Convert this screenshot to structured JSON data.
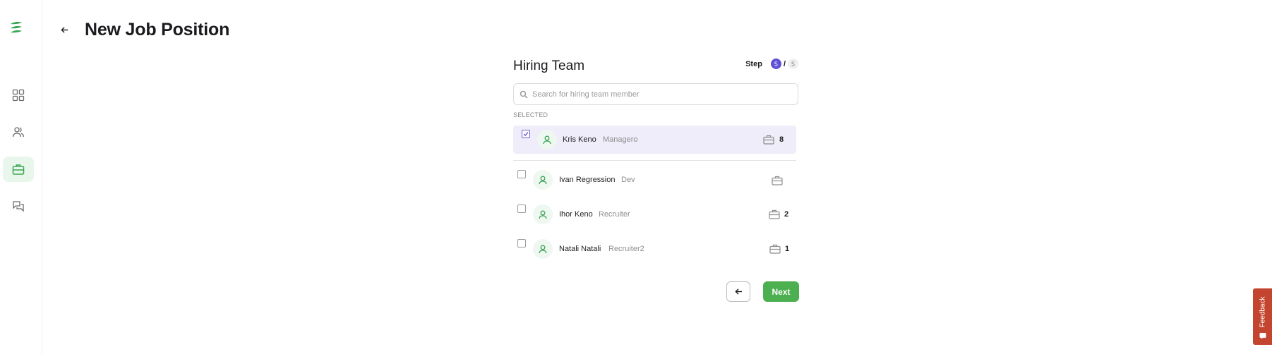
{
  "page": {
    "title": "New Job Position"
  },
  "sidebar": {
    "items": [
      {
        "name": "dashboard",
        "icon": "grid-icon"
      },
      {
        "name": "candidates",
        "icon": "users-icon"
      },
      {
        "name": "jobs",
        "icon": "briefcase-icon",
        "active": true
      },
      {
        "name": "messages",
        "icon": "chat-icon"
      }
    ]
  },
  "wizard": {
    "section_title": "Hiring Team",
    "step_label": "Step",
    "step_current": "5",
    "step_separator": "/",
    "step_total": "5"
  },
  "search": {
    "placeholder": "Search for hiring team member",
    "value": ""
  },
  "selected_label": "SELECTED",
  "selected_members": [
    {
      "name": "Kris Keno",
      "role": "Managero",
      "jobs": "8",
      "checked": true
    }
  ],
  "members": [
    {
      "name": "Ivan Regression",
      "role": "Dev",
      "jobs": "",
      "checked": false
    },
    {
      "name": "Ihor Keno",
      "role": "Recruiter",
      "jobs": "2",
      "checked": false
    },
    {
      "name": "Natali Natali",
      "role": "Recruiter2",
      "jobs": "1",
      "checked": false
    }
  ],
  "actions": {
    "next_label": "Next"
  },
  "feedback": {
    "label": "Feedback"
  },
  "colors": {
    "brand_green": "#4caf50",
    "step_accent": "#5d4fd6",
    "selected_row_bg": "#eeedf9",
    "feedback_bg": "#c4452f"
  }
}
